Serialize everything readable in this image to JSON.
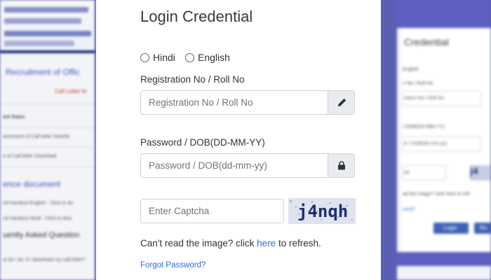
{
  "form": {
    "title": "Login Credential",
    "languages": [
      "Hindi",
      "English"
    ],
    "registration": {
      "label": "Registration No / Roll No",
      "placeholder": "Registration No / Roll No",
      "icon": "pencil-icon"
    },
    "password": {
      "label": "Password / DOB(DD-MM-YY)",
      "placeholder": "Password / DOB(dd-mm-yy)",
      "icon": "lock-icon"
    },
    "captcha": {
      "placeholder": "Enter Captcha",
      "image_text": "j4nqh"
    },
    "refresh_hint": {
      "prefix": "Can't read the image? click ",
      "link": "here",
      "suffix": " to refresh."
    },
    "forgot_password": "Forgot Password?"
  },
  "background_left": {
    "heading": "Recruitment of Offic",
    "call_letter": "Call Letter fo",
    "items": [
      "ant Dates",
      "ancement of Call letter Downlo",
      "e of Call letter Download"
    ],
    "reference": "ence document",
    "ref_items": [
      "nd Handout English - Click to do",
      "nd Handout Hindi - Click to dow"
    ],
    "faq": "uently Asked Question",
    "faq_item": "at do I do, if I download my call letter?"
  },
  "background_right": {
    "title": "Credential",
    "radio": "English",
    "label_reg": "n No / Roll No",
    "reg_input": "ration No / Roll No",
    "label_pw": "/ DOB(DD-MM-YY)",
    "pw_input": "d / DOB(dd-mm-yy)",
    "captcha_ph": "pa",
    "captcha_img": "j4",
    "hint": "ad the image? click here to refr",
    "link": "vord?",
    "login": "Login",
    "reset": "Re"
  },
  "colors": {
    "accent": "#5a5fb3",
    "link": "#2d6cdf",
    "title": "#3a3a3a"
  }
}
